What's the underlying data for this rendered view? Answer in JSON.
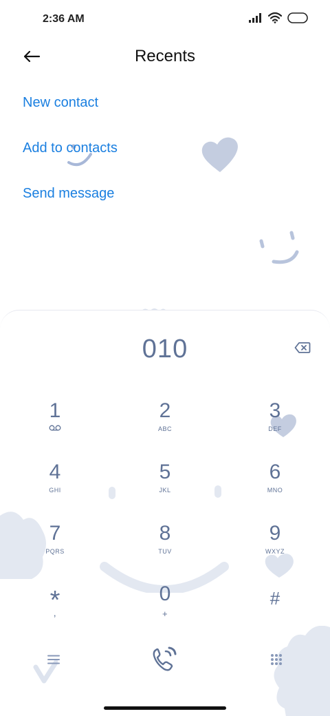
{
  "status_bar": {
    "time": "2:36 AM",
    "icons": [
      "signal-icon",
      "wifi-icon",
      "battery-icon"
    ]
  },
  "header": {
    "title": "Recents",
    "back_icon": "back-arrow-icon"
  },
  "actions": [
    {
      "label": "New contact"
    },
    {
      "label": "Add to contacts"
    },
    {
      "label": "Send message"
    }
  ],
  "dialer": {
    "number": "010",
    "keys": [
      {
        "digit": "1",
        "letters": "",
        "sub_icon": "voicemail-icon"
      },
      {
        "digit": "2",
        "letters": "ABC"
      },
      {
        "digit": "3",
        "letters": "DEF"
      },
      {
        "digit": "4",
        "letters": "GHI"
      },
      {
        "digit": "5",
        "letters": "JKL"
      },
      {
        "digit": "6",
        "letters": "MNO"
      },
      {
        "digit": "7",
        "letters": "PQRS"
      },
      {
        "digit": "8",
        "letters": "TUV"
      },
      {
        "digit": "9",
        "letters": "WXYZ"
      },
      {
        "digit": "*",
        "letters": ","
      },
      {
        "digit": "0",
        "letters": "+"
      },
      {
        "digit": "#",
        "letters": ""
      }
    ],
    "bottom_icons": [
      "menu-icon",
      "call-icon",
      "keypad-icon"
    ]
  },
  "colors": {
    "accent": "#1a7fe0",
    "dialer_text": "#5f7296",
    "decoration": "#c9d2e3"
  }
}
